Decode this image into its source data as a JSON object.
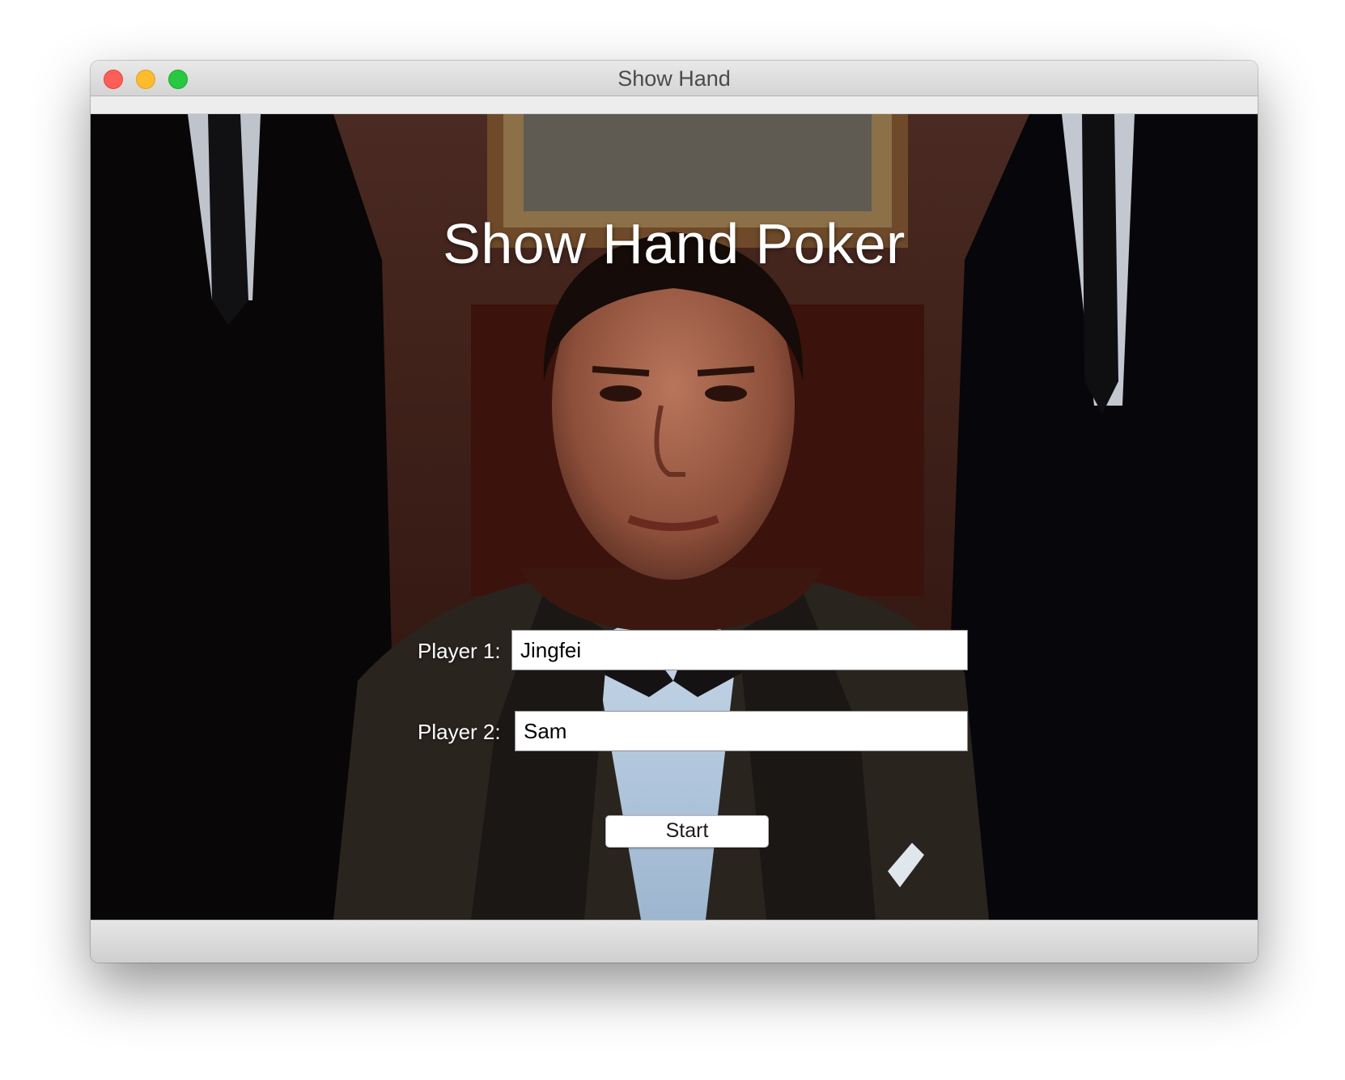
{
  "window": {
    "title": "Show Hand"
  },
  "game": {
    "title": "Show Hand Poker"
  },
  "form": {
    "player1": {
      "label": "Player 1:",
      "value": "Jingfei"
    },
    "player2": {
      "label": "Player 2:",
      "value": "Sam"
    },
    "start_label": "Start"
  },
  "icons": {
    "close": "close-traffic-light",
    "minimize": "minimize-traffic-light",
    "zoom": "zoom-traffic-light"
  },
  "colors": {
    "close": "#fc5f57",
    "minimize": "#fdbc2e",
    "zoom": "#28c840"
  }
}
